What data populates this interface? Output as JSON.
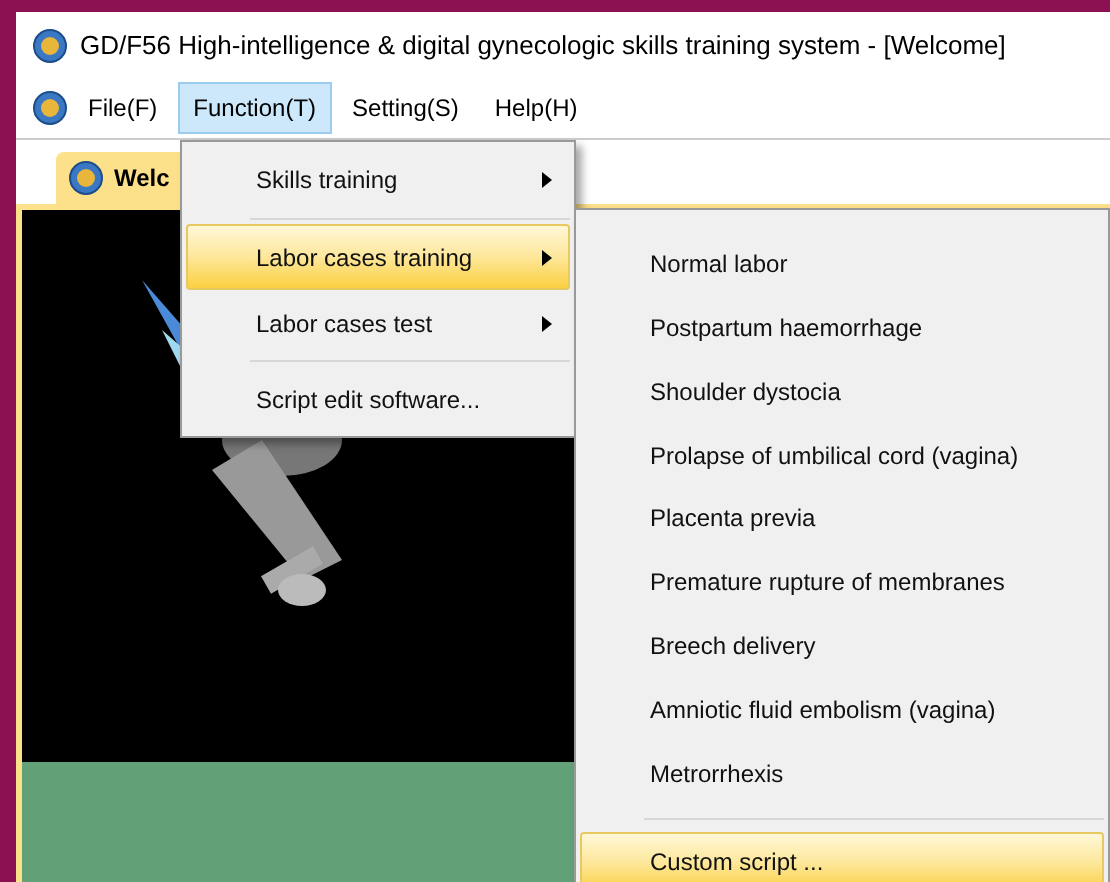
{
  "window": {
    "title": "GD/F56 High-intelligence & digital gynecologic skills training system - [Welcome]"
  },
  "menu_bar": [
    {
      "label": "File(F)",
      "selected": false
    },
    {
      "label": "Function(T)",
      "selected": true
    },
    {
      "label": "Setting(S)",
      "selected": false
    },
    {
      "label": "Help(H)",
      "selected": false
    }
  ],
  "tabs": [
    {
      "label": "Welc",
      "selected": true
    }
  ],
  "function_menu": [
    {
      "label": "Skills training",
      "submenu": true,
      "selected": false
    },
    {
      "label": "Labor cases training",
      "submenu": true,
      "selected": true
    },
    {
      "label": "Labor cases test",
      "submenu": true,
      "selected": false
    },
    {
      "label": "Script edit software...",
      "submenu": false,
      "selected": false
    }
  ],
  "labor_cases_submenu": [
    {
      "label": "Normal labor",
      "selected": false
    },
    {
      "label": "Postpartum haemorrhage",
      "selected": false
    },
    {
      "label": "Shoulder dystocia",
      "selected": false
    },
    {
      "label": "Prolapse of umbilical cord (vagina)",
      "selected": false
    },
    {
      "label": "Placenta previa",
      "selected": false
    },
    {
      "label": "Premature rupture of membranes",
      "selected": false
    },
    {
      "label": "Breech delivery",
      "selected": false
    },
    {
      "label": "Amniotic fluid embolism (vagina)",
      "selected": false
    },
    {
      "label": "Metrorrhexis",
      "selected": false
    },
    {
      "label": "Custom script ...",
      "selected": true
    }
  ]
}
